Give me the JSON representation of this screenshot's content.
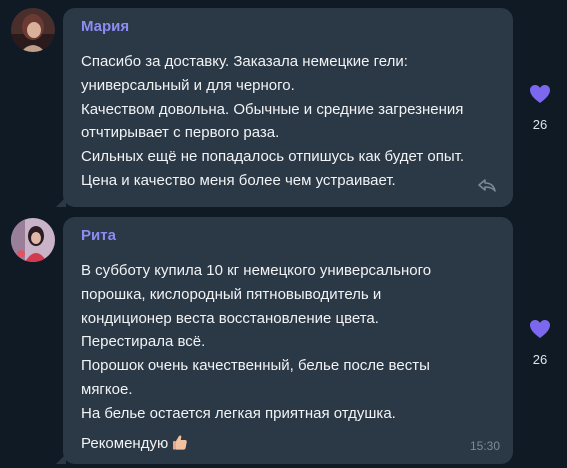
{
  "messages": [
    {
      "sender": "Мария",
      "text": "Спасибо за доставку. Заказала немецкие гели:\nуниверсальный и для черного.\nКачеством довольна. Обычные и средние загрезнения\nотчтирывает с первого раза.\nСильных ещё не попадалось отпишусь как будет опыт.\nЦена и качество меня более чем устраивает.",
      "reaction_count": "26"
    },
    {
      "sender": "Рита",
      "text": "В субботу купила 10 кг немецкого универсального\nпорошка, кислородный пятновыводитель и\nкондиционер веста восстановление цвета.\nПерестирала всё.\nПорошок очень качественный, белье после весты\nмягкое.\nНа белье остается легкая приятная отдушка.",
      "last_line": " Рекомендую",
      "time": "15:30",
      "reaction_count": "26"
    }
  ],
  "colors": {
    "background": "#0f1a25",
    "bubble": "#2b3846",
    "sender": "#8c8cf3",
    "heart": "#7b68ee"
  }
}
